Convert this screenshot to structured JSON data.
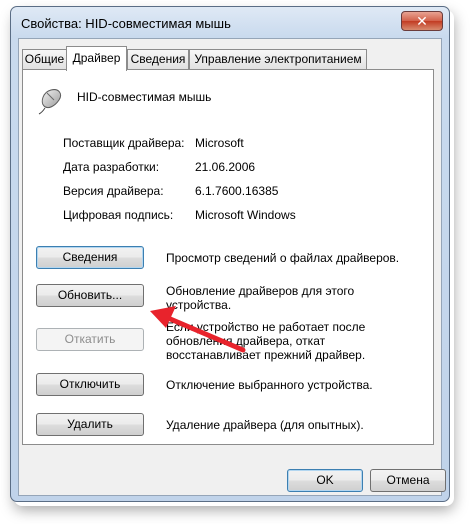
{
  "window": {
    "title": "Свойства: HID-совместимая мышь",
    "close_glyph": "✕"
  },
  "tabs": [
    {
      "label": "Общие"
    },
    {
      "label": "Драйвер"
    },
    {
      "label": "Сведения"
    },
    {
      "label": "Управление электропитанием"
    }
  ],
  "device": {
    "icon": "mouse-icon",
    "name": "HID-совместимая мышь"
  },
  "info": [
    {
      "label": "Поставщик драйвера:",
      "value": "Microsoft"
    },
    {
      "label": "Дата разработки:",
      "value": "21.06.2006"
    },
    {
      "label": "Версия драйвера:",
      "value": "6.1.7600.16385"
    },
    {
      "label": "Цифровая подпись:",
      "value": "Microsoft Windows"
    }
  ],
  "actions": [
    {
      "label": "Сведения",
      "description": "Просмотр сведений о файлах драйверов.",
      "enabled": true
    },
    {
      "label": "Обновить...",
      "description": "Обновление драйверов для этого устройства.",
      "enabled": true
    },
    {
      "label": "Откатить",
      "description": "Если устройство не работает после обновления драйвера, откат восстанавливает прежний драйвер.",
      "enabled": false
    },
    {
      "label": "Отключить",
      "description": "Отключение выбранного устройства.",
      "enabled": true
    },
    {
      "label": "Удалить",
      "description": "Удаление драйвера (для опытных).",
      "enabled": true
    }
  ],
  "footer": {
    "ok_label": "OK",
    "cancel_label": "Отмена"
  },
  "colors": {
    "annotation_arrow": "#e8232c",
    "title_bar": "#c9daee"
  }
}
